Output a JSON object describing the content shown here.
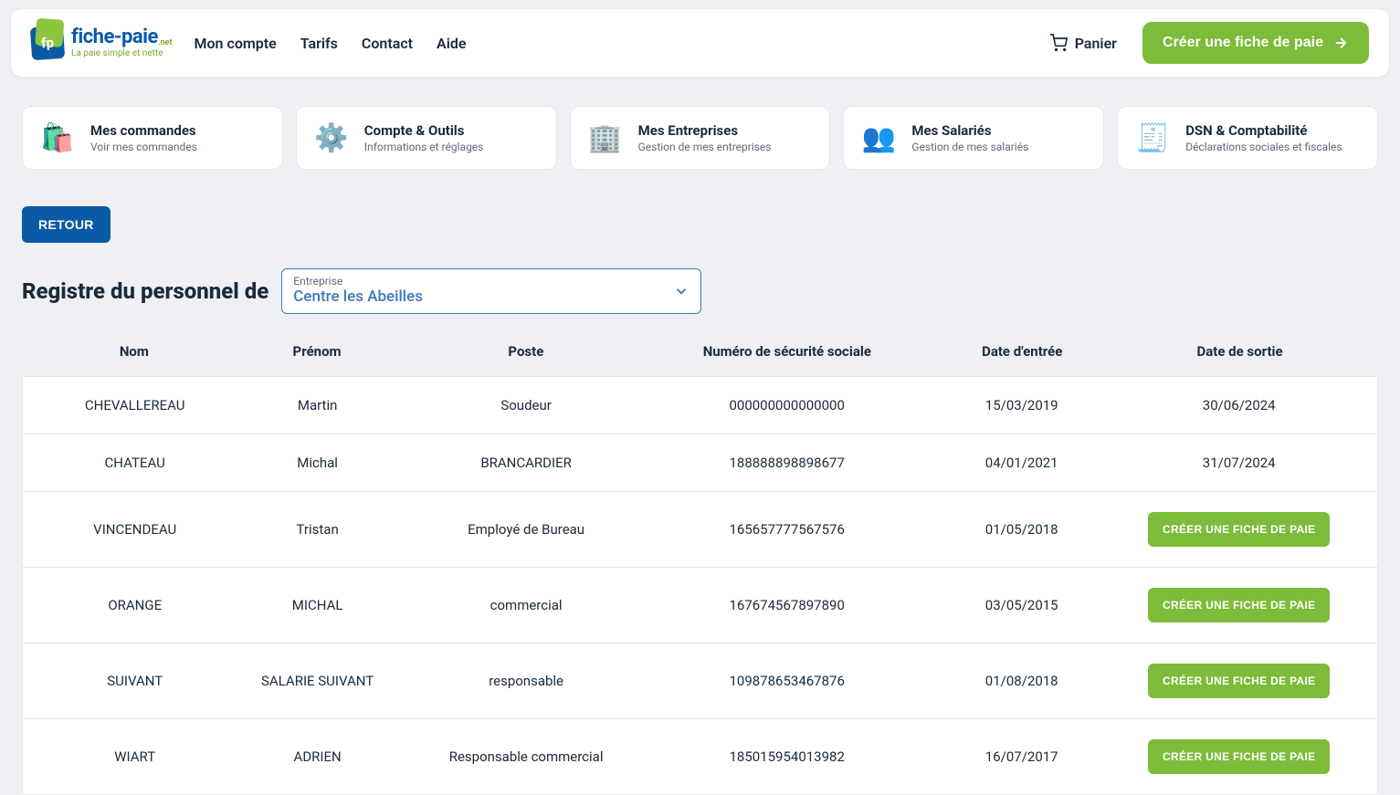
{
  "logo": {
    "badge_text": "fp",
    "main": "fiche-paie",
    "net": ".net",
    "tagline": "La paie simple et nette"
  },
  "nav": {
    "items": [
      "Mon compte",
      "Tarifs",
      "Contact",
      "Aide"
    ],
    "cart": "Panier",
    "create": "Créer une fiche de paie"
  },
  "tiles": [
    {
      "icon": "🛍️",
      "title": "Mes commandes",
      "sub": "Voir mes commandes"
    },
    {
      "icon": "⚙️",
      "title": "Compte & Outils",
      "sub": "Informations et réglages"
    },
    {
      "icon": "🏢",
      "title": "Mes Entreprises",
      "sub": "Gestion de mes entreprises"
    },
    {
      "icon": "👥",
      "title": "Mes Salariés",
      "sub": "Gestion de mes salariés"
    },
    {
      "icon": "🧾",
      "title": "DSN & Comptabilité",
      "sub": "Déclarations sociales et fiscales"
    }
  ],
  "back": "RETOUR",
  "page_title": "Registre du personnel de",
  "select": {
    "label": "Entreprise",
    "value": "Centre les Abeilles"
  },
  "table": {
    "headers": [
      "Nom",
      "Prénom",
      "Poste",
      "Numéro de sécurité sociale",
      "Date d'entrée",
      "Date de sortie"
    ],
    "create_label": "CRÉER UNE FICHE DE PAIE",
    "rows": [
      {
        "nom": "CHEVALLEREAU",
        "prenom": "Martin",
        "poste": "Soudeur",
        "ssn": "000000000000000",
        "entree": "15/03/2019",
        "sortie": "30/06/2024",
        "has_sortie": true
      },
      {
        "nom": "CHATEAU",
        "prenom": "Michal",
        "poste": "BRANCARDIER",
        "ssn": "188888898898677",
        "entree": "04/01/2021",
        "sortie": "31/07/2024",
        "has_sortie": true
      },
      {
        "nom": "VINCENDEAU",
        "prenom": "Tristan",
        "poste": "Employé de Bureau",
        "ssn": "165657777567576",
        "entree": "01/05/2018",
        "sortie": "",
        "has_sortie": false
      },
      {
        "nom": "ORANGE",
        "prenom": "MICHAL",
        "poste": "commercial",
        "ssn": "167674567897890",
        "entree": "03/05/2015",
        "sortie": "",
        "has_sortie": false
      },
      {
        "nom": "SUIVANT",
        "prenom": "SALARIE SUIVANT",
        "poste": "responsable",
        "ssn": "109878653467876",
        "entree": "01/08/2018",
        "sortie": "",
        "has_sortie": false
      },
      {
        "nom": "WIART",
        "prenom": "ADRIEN",
        "poste": "Responsable commercial",
        "ssn": "185015954013982",
        "entree": "16/07/2017",
        "sortie": "",
        "has_sortie": false
      }
    ]
  }
}
